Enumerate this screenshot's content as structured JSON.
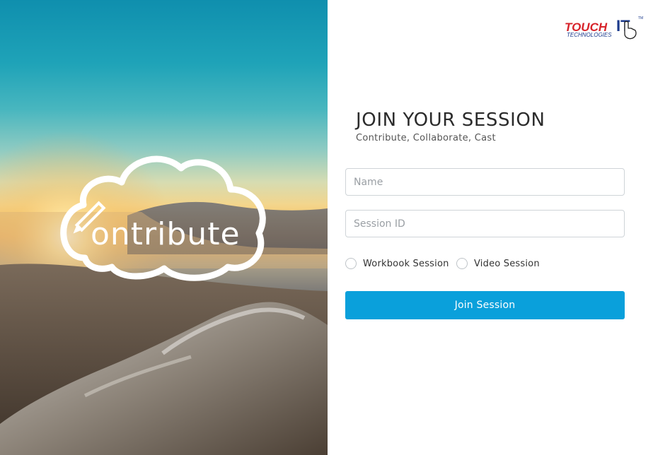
{
  "hero": {
    "brand_word": "ontribute",
    "logo_icon": "cloud-pencil-icon"
  },
  "logo": {
    "word_1": "TOUCH",
    "word_2": "IT",
    "tagline": "TECHNOLOGIES",
    "tm": "TM",
    "icon": "hand-pointer-icon"
  },
  "form": {
    "title": "JOIN YOUR SESSION",
    "subtitle": "Contribute, Collaborate, Cast",
    "name_placeholder": "Name",
    "session_placeholder": "Session ID",
    "radio_workbook": "Workbook Session",
    "radio_video": "Video Session",
    "submit_label": "Join Session"
  },
  "colors": {
    "accent": "#0aa0db",
    "logo_red": "#d7232a",
    "logo_blue": "#1b3a8c"
  }
}
